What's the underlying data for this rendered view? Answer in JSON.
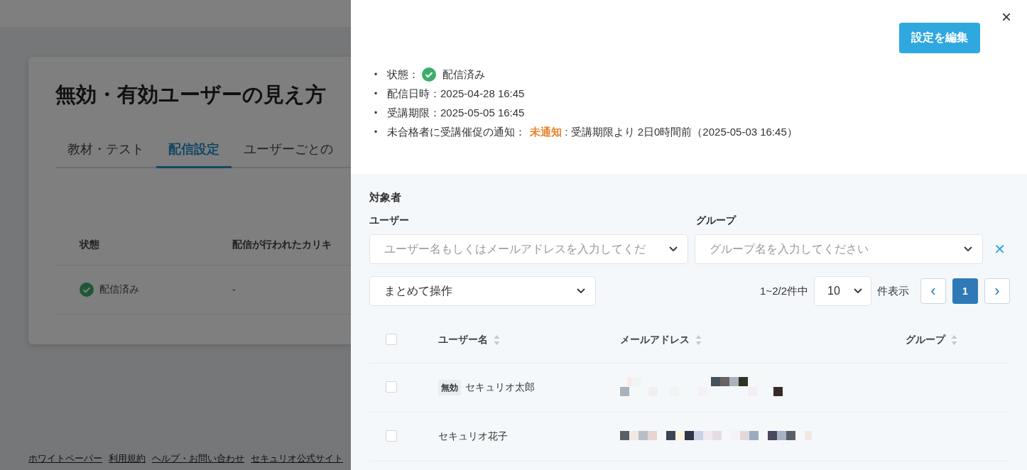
{
  "background_page": {
    "title": "無効・有効ユーザーの見え方",
    "tabs": [
      {
        "label": "教材・テスト",
        "selected": false
      },
      {
        "label": "配信設定",
        "selected": true
      },
      {
        "label": "ユーザーごとの",
        "selected": false
      }
    ],
    "table": {
      "columns": [
        "状態",
        "配信が行われたカリキ"
      ],
      "rows": [
        {
          "status": "配信済み",
          "column_2": "-"
        }
      ]
    },
    "footer_links": [
      "ホワイトペーパー",
      "利用規約",
      "ヘルプ・お問い合わせ",
      "セキュリオ公式サイト"
    ]
  },
  "drawer": {
    "close": "×",
    "edit_button": "設定を編集",
    "details": [
      {
        "bullet": "•",
        "label": "状態：",
        "value": "配信済み",
        "kind": "status"
      },
      {
        "bullet": "•",
        "label": "配信日時：",
        "value": "2025-04-28 16:45",
        "kind": "plain"
      },
      {
        "bullet": "•",
        "label": "受講期限：",
        "value": "2025-05-05 16:45",
        "kind": "plain"
      },
      {
        "bullet": "•",
        "label": "未合格者に受講催促の通知：",
        "value": "未通知",
        "note": ": 受講期限より 2日0時間前（2025-05-03 16:45）",
        "kind": "notice"
      }
    ],
    "targets": {
      "title": "対象者",
      "user_label": "ユーザー",
      "user_placeholder": "ユーザー名もしくはメールアドレスを入力してくだ",
      "group_label": "グループ",
      "group_placeholder": "グループ名を入力してください",
      "clear": "✕",
      "bulk_action": "まとめて操作",
      "range": "1~2/2件中",
      "page_size": "10",
      "page_size_suffix": "件表示",
      "prev": "‹",
      "next": "›",
      "pages": [
        {
          "label": "1",
          "selected": true
        }
      ],
      "columns": [
        "ユーザー名",
        "メールアドレス",
        "グループ"
      ],
      "select_all_checked": false,
      "rows": [
        {
          "checked": false,
          "badge": "無効",
          "name": "セキュリオ太郎",
          "email": {
            "kind": "mosaic"
          }
        },
        {
          "checked": false,
          "name": "セキュリオ花子",
          "email": {
            "kind": "mosaic"
          }
        }
      ]
    }
  }
}
